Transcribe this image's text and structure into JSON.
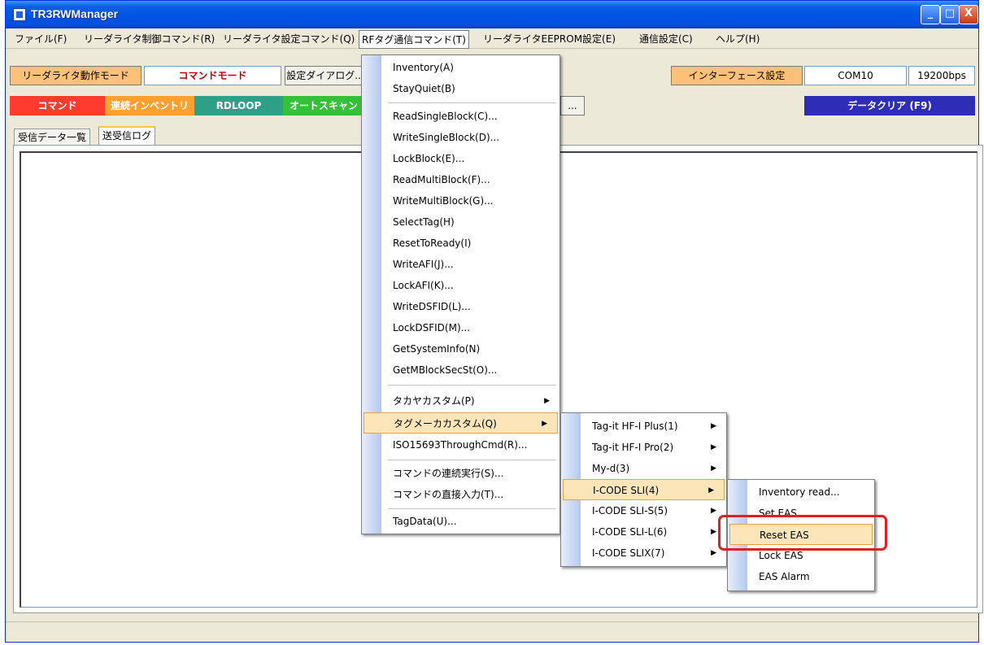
{
  "window": {
    "title": "TR3RWManager",
    "min": "_",
    "max": "□",
    "close": "X"
  },
  "menubar": [
    "ファイル(F)",
    "リーダライタ制御コマンド(R)",
    "リーダライタ設定コマンド(Q)",
    "RFタグ通信コマンド(T)",
    "リーダライタEEPROM設定(E)",
    "通信設定(C)",
    "ヘルプ(H)"
  ],
  "toolbar": {
    "mode_label": "リーダライタ動作モード",
    "mode_value": "コマンドモード",
    "settings_dialog": "設定ダイアログ...",
    "interface_label": "インターフェース設定",
    "port": "COM10",
    "baud": "19200bps",
    "hidden_button_tail": "..."
  },
  "buttons": [
    {
      "label": "コマンド",
      "color": "#ff3b2f"
    },
    {
      "label": "連続インベントリ",
      "color": "#ffa030"
    },
    {
      "label": "RDLOOP",
      "color": "#2f9f88"
    },
    {
      "label": "オートスキャン",
      "color": "#36c03a"
    }
  ],
  "clear_button": {
    "label": "データクリア (F9)",
    "color": "#2d2db8"
  },
  "tabs": [
    "受信データ一覧",
    "送受信ログ"
  ],
  "rf_menu": [
    "Inventory(A)",
    "StayQuiet(B)",
    "ReadSingleBlock(C)...",
    "WriteSingleBlock(D)...",
    "LockBlock(E)...",
    "ReadMultiBlock(F)...",
    "WriteMultiBlock(G)...",
    "SelectTag(H)",
    "ResetToReady(I)",
    "WriteAFI(J)...",
    "LockAFI(K)...",
    "WriteDSFID(L)...",
    "LockDSFID(M)...",
    "GetSystemInfo(N)",
    "GetMBlockSecSt(O)...",
    "タカヤカスタム(P)",
    "タグメーカカスタム(Q)",
    "ISO15693ThroughCmd(R)...",
    "コマンドの連続実行(S)...",
    "コマンドの直接入力(T)...",
    "TagData(U)..."
  ],
  "maker_menu": [
    "Tag-it HF-I Plus(1)",
    "Tag-it HF-I Pro(2)",
    "My-d(3)",
    "I-CODE SLI(4)",
    "I-CODE SLI-S(5)",
    "I-CODE SLI-L(6)",
    "I-CODE SLIX(7)"
  ],
  "icode_menu": [
    "Inventory read...",
    "Set EAS",
    "Reset EAS",
    "Lock EAS",
    "EAS Alarm"
  ]
}
